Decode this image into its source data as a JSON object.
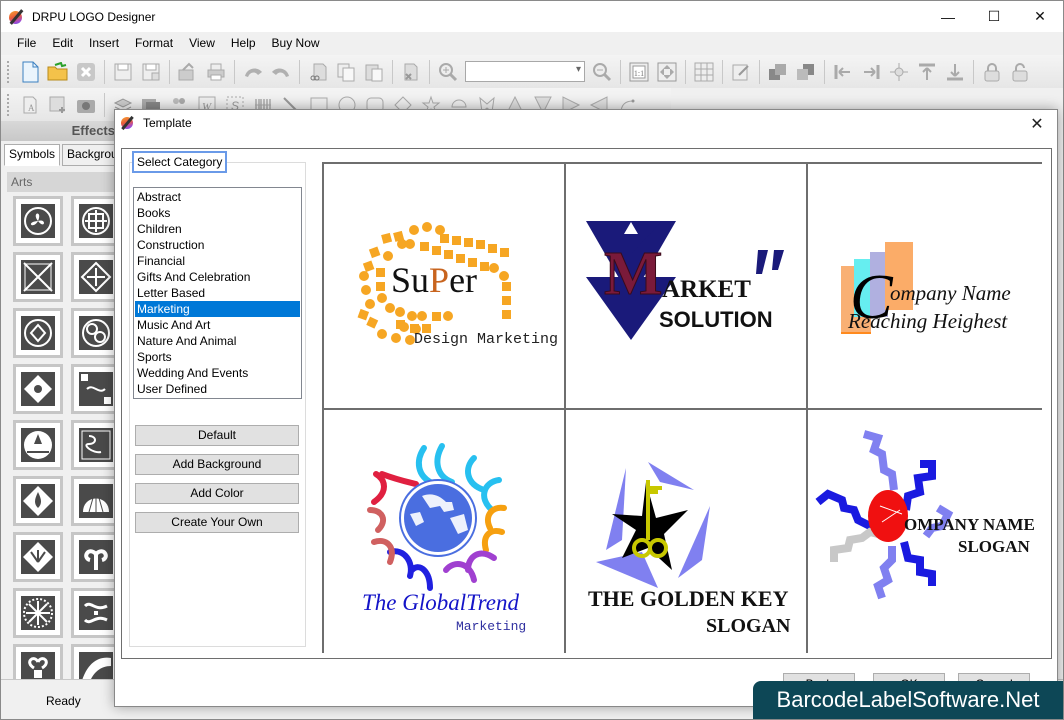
{
  "app": {
    "title": "DRPU LOGO Designer",
    "window_controls": {
      "minimize": "—",
      "maximize": "☐",
      "close": "✕"
    }
  },
  "menu": [
    "File",
    "Edit",
    "Insert",
    "Format",
    "View",
    "Help",
    "Buy Now"
  ],
  "toolbar1": {
    "icons": [
      "new-file-icon",
      "open-folder-icon",
      "close-file-icon",
      "save-icon",
      "save-as-icon",
      "export-icon",
      "print-icon",
      "undo-icon",
      "redo-icon",
      "cut-icon",
      "copy-icon",
      "paste-icon",
      "delete-icon",
      "zoom-in-icon",
      "zoom-combo",
      "zoom-out-icon",
      "actual-size-icon",
      "fit-to-window-icon",
      "grid-icon",
      "edit-properties-icon",
      "bring-forward-icon",
      "send-backward-icon",
      "align-left-icon",
      "align-right-icon",
      "align-center-icon",
      "align-top-icon",
      "align-bottom-icon",
      "lock-icon",
      "unlock-icon"
    ],
    "zoom_value": ""
  },
  "toolbar2": {
    "icons": [
      "text-icon",
      "image-icon",
      "camera-icon",
      "layers-icon",
      "picture-icon",
      "users-icon",
      "word-art-icon",
      "signature-icon",
      "barcode-icon",
      "line-icon",
      "rectangle-icon",
      "ellipse-icon",
      "rounded-rect-icon",
      "diamond-icon",
      "star-icon",
      "arc-icon",
      "hourglass-icon",
      "triangle-up-icon",
      "triangle-down-icon",
      "triangle-right-icon",
      "triangle-left-icon",
      "curve-icon"
    ]
  },
  "left_panel": {
    "header": "Effects",
    "tabs": [
      "Symbols",
      "Backgrounds"
    ],
    "section": "Arts",
    "symbols": [
      "triskele-symbol",
      "celtic-knot-symbol",
      "star-cross-symbol",
      "diamond-knot-symbol",
      "circle-knot-symbol",
      "quatrefoil-symbol",
      "cross-ornament-symbol",
      "swirl-dots-symbol",
      "lotus-symbol",
      "scroll-symbol",
      "fleur-diamond-symbol",
      "shell-fan-symbol",
      "fan-diamond-symbol",
      "tree-symbol",
      "mandala-symbol",
      "scroll-ornament-symbol",
      "heart-ornament-symbol",
      "wing-symbol"
    ]
  },
  "status": {
    "text": "Ready"
  },
  "dialog": {
    "title": "Template",
    "close": "✕",
    "category_label": "Select Category",
    "categories": [
      "Abstract",
      "Books",
      "Children",
      "Construction",
      "Financial",
      "Gifts And Celebration",
      "Letter Based",
      "Marketing",
      "Music And Art",
      "Nature And Animal",
      "Sports",
      "Wedding And Events",
      "User Defined"
    ],
    "selected_category": "Marketing",
    "buttons": {
      "default": "Default",
      "add_background": "Add Background",
      "add_color": "Add Color",
      "create_your_own": "Create Your Own"
    },
    "footer_buttons": {
      "back": "Back",
      "ok": "OK",
      "cancel": "Cancel"
    },
    "templates": [
      {
        "name": "super-design-marketing",
        "title_a": "Su",
        "title_b": "P",
        "title_c": "er",
        "subtitle": "Design Marketing",
        "color": "#f6a623"
      },
      {
        "name": "market-solution",
        "initial": "M",
        "title": "ARKET",
        "subtitle": "SOLUTION",
        "color": "#1a1a7a",
        "accent": "#7a1a3a"
      },
      {
        "name": "company-name-reaching",
        "initial": "C",
        "title": "ompany Name",
        "subtitle": "Reaching Heighest"
      },
      {
        "name": "global-trend",
        "title": "The GlobalTrend",
        "subtitle": "Marketing",
        "color": "#1414c8"
      },
      {
        "name": "golden-key",
        "title": "THE GOLDEN KEY",
        "subtitle": "SLOGAN",
        "color": "#8080f0",
        "key_color": "#c8c800"
      },
      {
        "name": "company-name-slogan",
        "title": "OMPANY NAME",
        "subtitle": "SLOGAN",
        "color": "#1a1ae0",
        "accent": "#f01010"
      }
    ]
  },
  "watermark": {
    "text": "BarcodeLabelSoftware.Net",
    "bg": "#0d4756"
  }
}
